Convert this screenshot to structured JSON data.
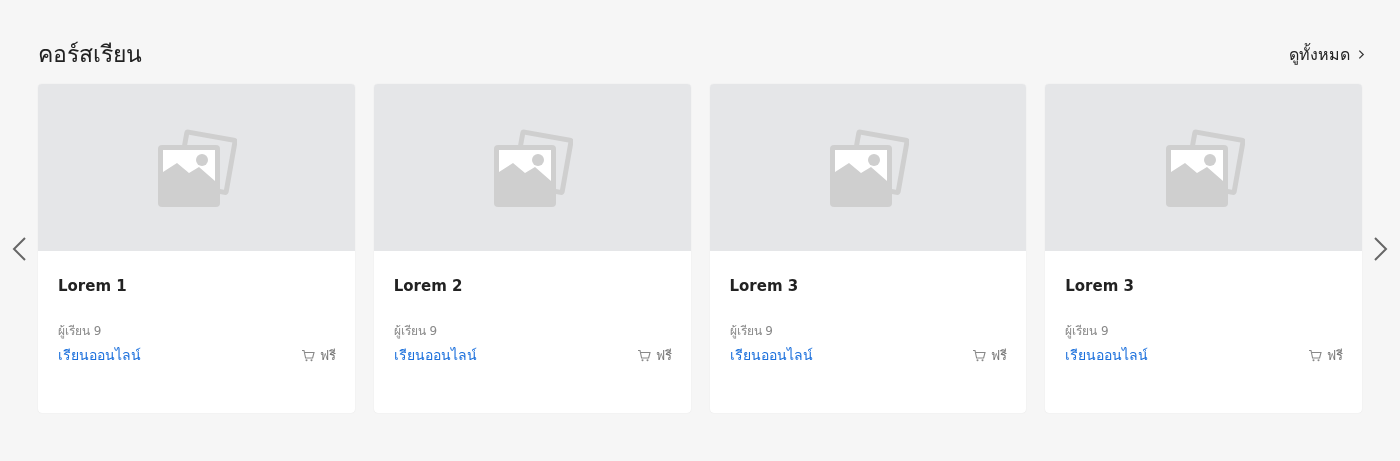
{
  "section": {
    "title": "คอร์สเรียน",
    "view_all": "ดูทั้งหมด"
  },
  "courses": [
    {
      "title": "Lorem 1",
      "learners": "ผู้เรียน 9",
      "mode": "เรียนออนไลน์",
      "price": "ฟรี"
    },
    {
      "title": "Lorem 2",
      "learners": "ผู้เรียน 9",
      "mode": "เรียนออนไลน์",
      "price": "ฟรี"
    },
    {
      "title": "Lorem 3",
      "learners": "ผู้เรียน 9",
      "mode": "เรียนออนไลน์",
      "price": "ฟรี"
    },
    {
      "title": "Lorem 3",
      "learners": "ผู้เรียน 9",
      "mode": "เรียนออนไลน์",
      "price": "ฟรี"
    }
  ]
}
